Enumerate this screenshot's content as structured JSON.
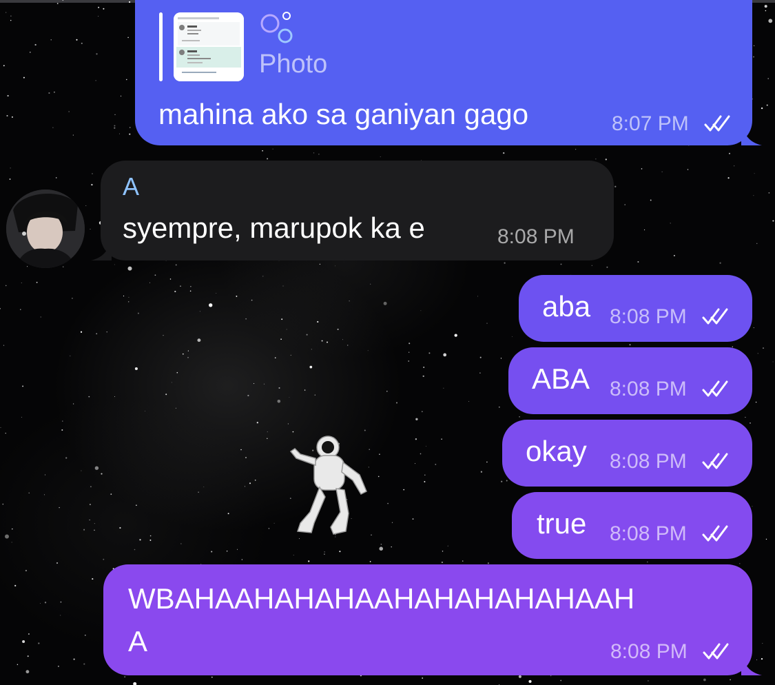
{
  "chat": {
    "messages": [
      {
        "id": "m1",
        "direction": "outgoing",
        "reply": {
          "label": "Photo"
        },
        "text": "mahina ako sa ganiyan gago",
        "time": "8:07 PM",
        "read": true
      },
      {
        "id": "m2",
        "direction": "incoming",
        "sender": "A",
        "text": "syempre, marupok ka e",
        "time": "8:08 PM"
      },
      {
        "id": "m3",
        "direction": "outgoing",
        "text": "aba",
        "time": "8:08 PM",
        "read": true
      },
      {
        "id": "m4",
        "direction": "outgoing",
        "text": "ABA",
        "time": "8:08 PM",
        "read": true
      },
      {
        "id": "m5",
        "direction": "outgoing",
        "text": "okay",
        "time": "8:08 PM",
        "read": true
      },
      {
        "id": "m6",
        "direction": "outgoing",
        "text": "true",
        "time": "8:08 PM",
        "read": true
      },
      {
        "id": "m7",
        "direction": "outgoing",
        "text_line1": "WBAHAAHAHAHAAHAHAHAHAHAAH",
        "text_line2": "A",
        "time": "8:08 PM",
        "read": true
      }
    ]
  },
  "colors": {
    "outgoing_bubble_top": "#5560f2",
    "outgoing_bubble_bottom": "#8a49ee",
    "incoming_bubble": "#1c1c1e",
    "sender_name": "#8fc3ff",
    "background": "#050506"
  },
  "icons": {
    "read_receipt": "double-check-icon",
    "reply_media": "bubbles-icon",
    "backdrop": "astronaut-in-space"
  }
}
